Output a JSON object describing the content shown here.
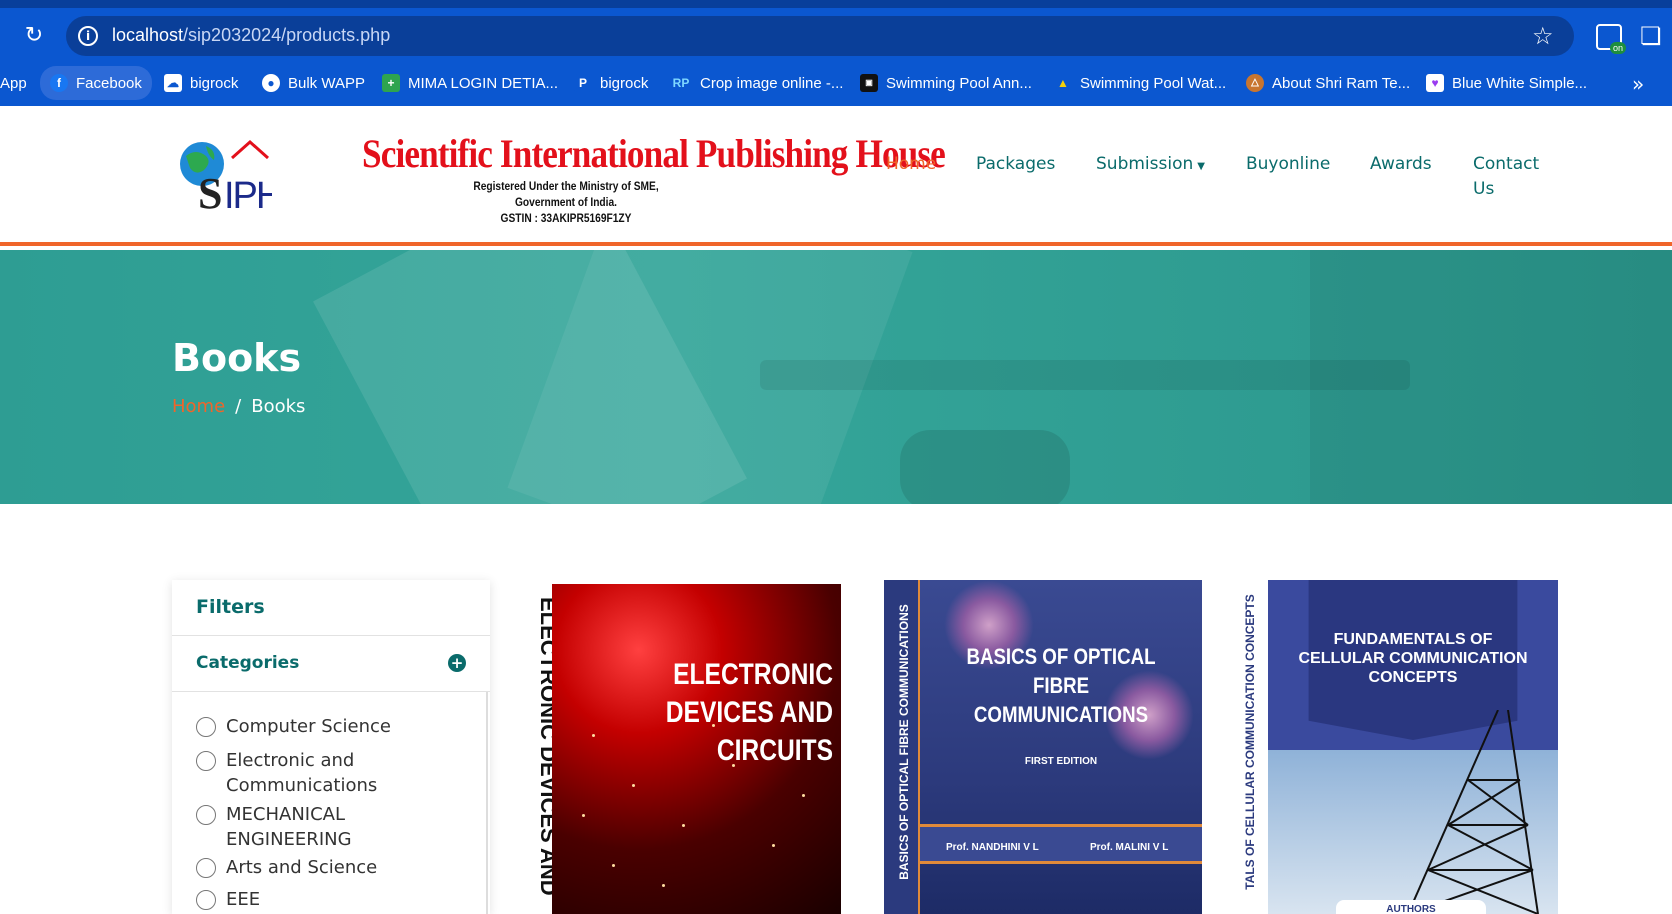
{
  "browser": {
    "url_host": "localhost",
    "url_path": "/sip2032024/products.php",
    "bookmarks": [
      {
        "label": "App",
        "icon": "apps-icon"
      },
      {
        "label": "Facebook",
        "icon": "facebook-icon"
      },
      {
        "label": "bigrock",
        "icon": "cloud-icon"
      },
      {
        "label": "Bulk WAPP",
        "icon": "globe-icon"
      },
      {
        "label": "MIMA LOGIN DETIA...",
        "icon": "plus-icon"
      },
      {
        "label": "bigrock",
        "icon": "p-icon"
      },
      {
        "label": "Crop image online -...",
        "icon": "rp-icon"
      },
      {
        "label": "Swimming Pool Ann...",
        "icon": "film-icon"
      },
      {
        "label": "Swimming Pool Wat...",
        "icon": "triangle-icon"
      },
      {
        "label": "About Shri Ram Te...",
        "icon": "temple-icon"
      },
      {
        "label": "Blue White Simple...",
        "icon": "heart-icon"
      }
    ]
  },
  "site": {
    "brand_title": "Scientific International Publishing House",
    "brand_line1": "Registered Under the Ministry of SME,",
    "brand_line2": "Government of India.",
    "brand_line3": "GSTIN : 33AKIPR5169F1ZY",
    "logo_text": "SIPH",
    "nav": {
      "home": "Home",
      "packages": "Packages",
      "submission": "Submission",
      "buyonline": "Buyonline",
      "awards": "Awards",
      "contact_line1": "Contact",
      "contact_line2": "Us"
    },
    "colors": {
      "accent": "#f0652a",
      "primary": "#0a6b6b",
      "hero": "#2e9d93",
      "brand_red": "#e3101b"
    }
  },
  "hero": {
    "title": "Books",
    "breadcrumb_home": "Home",
    "breadcrumb_sep": "/",
    "breadcrumb_current": "Books"
  },
  "filters": {
    "title": "Filters",
    "categories_label": "Categories",
    "categories": [
      {
        "line1": "Computer Science",
        "line2": ""
      },
      {
        "line1": "Electronic and",
        "line2": "Communications"
      },
      {
        "line1": "MECHANICAL",
        "line2": "ENGINEERING"
      },
      {
        "line1": "Arts and Science",
        "line2": ""
      },
      {
        "line1": "EEE",
        "line2": ""
      }
    ]
  },
  "books": [
    {
      "title_line1": "ELECTRONIC DEVICES AND",
      "title_line2": "CIRCUITS",
      "spine": "ELECTRONIC DEVICES AND"
    },
    {
      "title_line1": "BASICS OF OPTICAL",
      "title_line2": "FIBRE",
      "title_line3": "COMMUNICATIONS",
      "edition": "FIRST EDITION",
      "author1": "Prof. NANDHINI V L",
      "author2": "Prof. MALINI V L",
      "spine": "BASICS OF OPTICAL FIBRE COMMUNICATIONS"
    },
    {
      "title_line1": "FUNDAMENTALS OF",
      "title_line2": "CELLULAR COMMUNICATION",
      "title_line3": "CONCEPTS",
      "spine": "TALS OF CELLULAR COMMUNICATION CONCEPTS",
      "authors_label": "AUTHORS"
    }
  ]
}
